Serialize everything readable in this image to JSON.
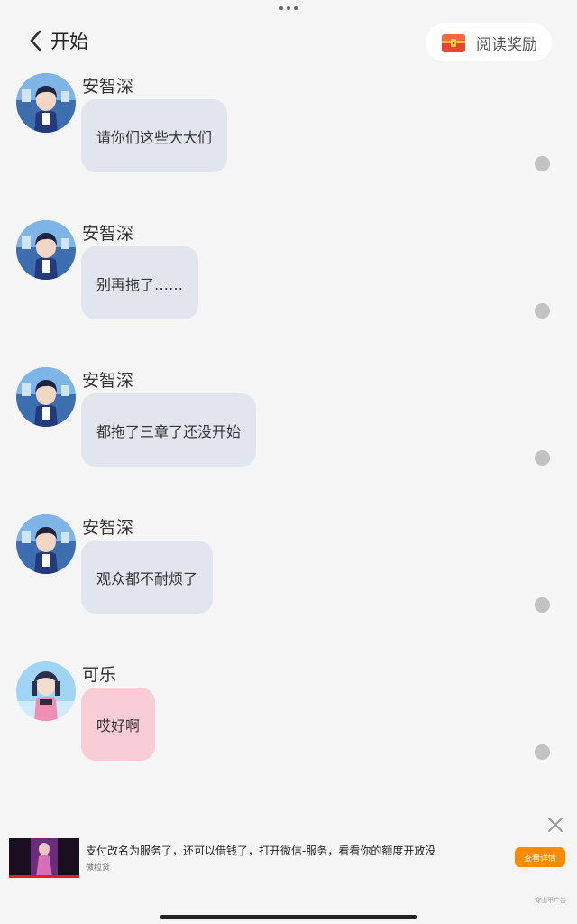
{
  "header": {
    "back_label": "开始",
    "reward_label": "阅读奖励"
  },
  "messages": [
    {
      "sender": "安智深",
      "text": "请你们这些大大们",
      "avatar": "boy-avatar",
      "bubble_color": "#e1e6ee"
    },
    {
      "sender": "安智深",
      "text": "别再拖了……",
      "avatar": "boy-avatar",
      "bubble_color": "#e1e6ee"
    },
    {
      "sender": "安智深",
      "text": "都拖了三章了还没开始",
      "avatar": "boy-avatar",
      "bubble_color": "#e1e6ee"
    },
    {
      "sender": "安智深",
      "text": "观众都不耐烦了",
      "avatar": "boy-avatar",
      "bubble_color": "#e1e6ee"
    },
    {
      "sender": "可乐",
      "text": "哎好啊",
      "avatar": "girl-avatar",
      "bubble_color": "#f9cdd6"
    }
  ],
  "ad": {
    "title": "支付改名为服务了，还可以借钱了，打开微信-服务，看看你的额度开放没",
    "source": "微粒贷",
    "cta_label": "查看详情",
    "tag": "穿山甲广告"
  },
  "colors": {
    "background": "#f5f5f5",
    "bubble_default": "#e1e6ee",
    "bubble_pink": "#f9cdd6",
    "cta": "#ff8a00"
  }
}
